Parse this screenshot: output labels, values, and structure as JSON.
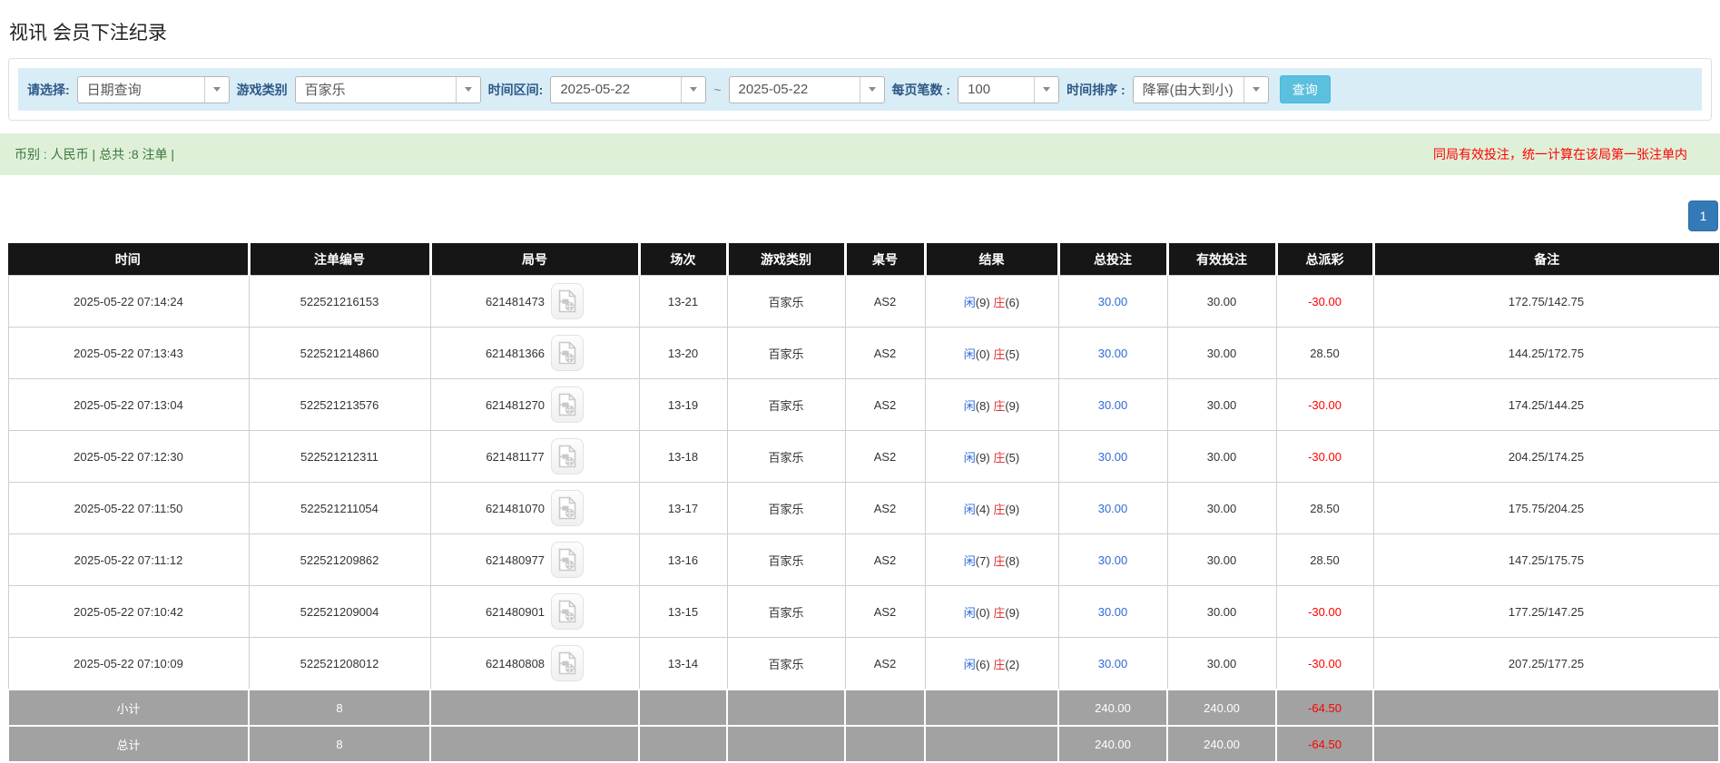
{
  "page_title": "视讯 会员下注纪录",
  "filter": {
    "select_label": "请选择:",
    "select_value": "日期查询",
    "game_type_label": "游戏类别",
    "game_type_value": "百家乐",
    "time_range_label": "时间区间:",
    "date_from": "2025-05-22",
    "date_separator": "~",
    "date_to": "2025-05-22",
    "page_size_label": "每页笔数 :",
    "page_size_value": "100",
    "sort_label": "时间排序 :",
    "sort_value": "降幂(由大到小)",
    "search_button": "查询"
  },
  "summary_bar": {
    "left_text": "币别 : 人民币 | 总共 :8 注单 |",
    "right_notice": "同局有效投注，统一计算在该局第一张注单内"
  },
  "pagination": {
    "current_page": "1"
  },
  "table": {
    "headers": [
      "时间",
      "注单编号",
      "局号",
      "场次",
      "游戏类别",
      "桌号",
      "结果",
      "总投注",
      "有效投注",
      "总派彩",
      "备注"
    ],
    "rows": [
      {
        "time": "2025-05-22 07:14:24",
        "bet_id": "522521216153",
        "round_id": "621481473",
        "session": "13-21",
        "game": "百家乐",
        "table_id": "AS2",
        "result": {
          "player": "闲",
          "player_score": "(9)",
          "banker": "庄",
          "banker_score": "(6)"
        },
        "total_bet": "30.00",
        "valid_bet": "30.00",
        "payout": "-30.00",
        "remark": "172.75/142.75"
      },
      {
        "time": "2025-05-22 07:13:43",
        "bet_id": "522521214860",
        "round_id": "621481366",
        "session": "13-20",
        "game": "百家乐",
        "table_id": "AS2",
        "result": {
          "player": "闲",
          "player_score": "(0)",
          "banker": "庄",
          "banker_score": "(5)"
        },
        "total_bet": "30.00",
        "valid_bet": "30.00",
        "payout": "28.50",
        "remark": "144.25/172.75"
      },
      {
        "time": "2025-05-22 07:13:04",
        "bet_id": "522521213576",
        "round_id": "621481270",
        "session": "13-19",
        "game": "百家乐",
        "table_id": "AS2",
        "result": {
          "player": "闲",
          "player_score": "(8)",
          "banker": "庄",
          "banker_score": "(9)"
        },
        "total_bet": "30.00",
        "valid_bet": "30.00",
        "payout": "-30.00",
        "remark": "174.25/144.25"
      },
      {
        "time": "2025-05-22 07:12:30",
        "bet_id": "522521212311",
        "round_id": "621481177",
        "session": "13-18",
        "game": "百家乐",
        "table_id": "AS2",
        "result": {
          "player": "闲",
          "player_score": "(9)",
          "banker": "庄",
          "banker_score": "(5)"
        },
        "total_bet": "30.00",
        "valid_bet": "30.00",
        "payout": "-30.00",
        "remark": "204.25/174.25"
      },
      {
        "time": "2025-05-22 07:11:50",
        "bet_id": "522521211054",
        "round_id": "621481070",
        "session": "13-17",
        "game": "百家乐",
        "table_id": "AS2",
        "result": {
          "player": "闲",
          "player_score": "(4)",
          "banker": "庄",
          "banker_score": "(9)"
        },
        "total_bet": "30.00",
        "valid_bet": "30.00",
        "payout": "28.50",
        "remark": "175.75/204.25"
      },
      {
        "time": "2025-05-22 07:11:12",
        "bet_id": "522521209862",
        "round_id": "621480977",
        "session": "13-16",
        "game": "百家乐",
        "table_id": "AS2",
        "result": {
          "player": "闲",
          "player_score": "(7)",
          "banker": "庄",
          "banker_score": "(8)"
        },
        "total_bet": "30.00",
        "valid_bet": "30.00",
        "payout": "28.50",
        "remark": "147.25/175.75"
      },
      {
        "time": "2025-05-22 07:10:42",
        "bet_id": "522521209004",
        "round_id": "621480901",
        "session": "13-15",
        "game": "百家乐",
        "table_id": "AS2",
        "result": {
          "player": "闲",
          "player_score": "(0)",
          "banker": "庄",
          "banker_score": "(9)"
        },
        "total_bet": "30.00",
        "valid_bet": "30.00",
        "payout": "-30.00",
        "remark": "177.25/147.25"
      },
      {
        "time": "2025-05-22 07:10:09",
        "bet_id": "522521208012",
        "round_id": "621480808",
        "session": "13-14",
        "game": "百家乐",
        "table_id": "AS2",
        "result": {
          "player": "闲",
          "player_score": "(6)",
          "banker": "庄",
          "banker_score": "(2)"
        },
        "total_bet": "30.00",
        "valid_bet": "30.00",
        "payout": "-30.00",
        "remark": "207.25/177.25"
      }
    ],
    "footer": [
      {
        "label": "小计",
        "count": "8",
        "total_bet": "240.00",
        "valid_bet": "240.00",
        "payout": "-64.50"
      },
      {
        "label": "总计",
        "count": "8",
        "total_bet": "240.00",
        "valid_bet": "240.00",
        "payout": "-64.50"
      }
    ]
  },
  "colors": {
    "header_bg": "#161616",
    "footer_bg": "#a2a2a2",
    "filter_bg": "#d9edf7",
    "summary_bg": "#dff0d8",
    "link_blue": "#2e6bd8",
    "result_red": "#e03636",
    "loss_red": "#ff0000",
    "search_button_bg": "#5bc0de",
    "page_button_bg": "#337ab7"
  }
}
